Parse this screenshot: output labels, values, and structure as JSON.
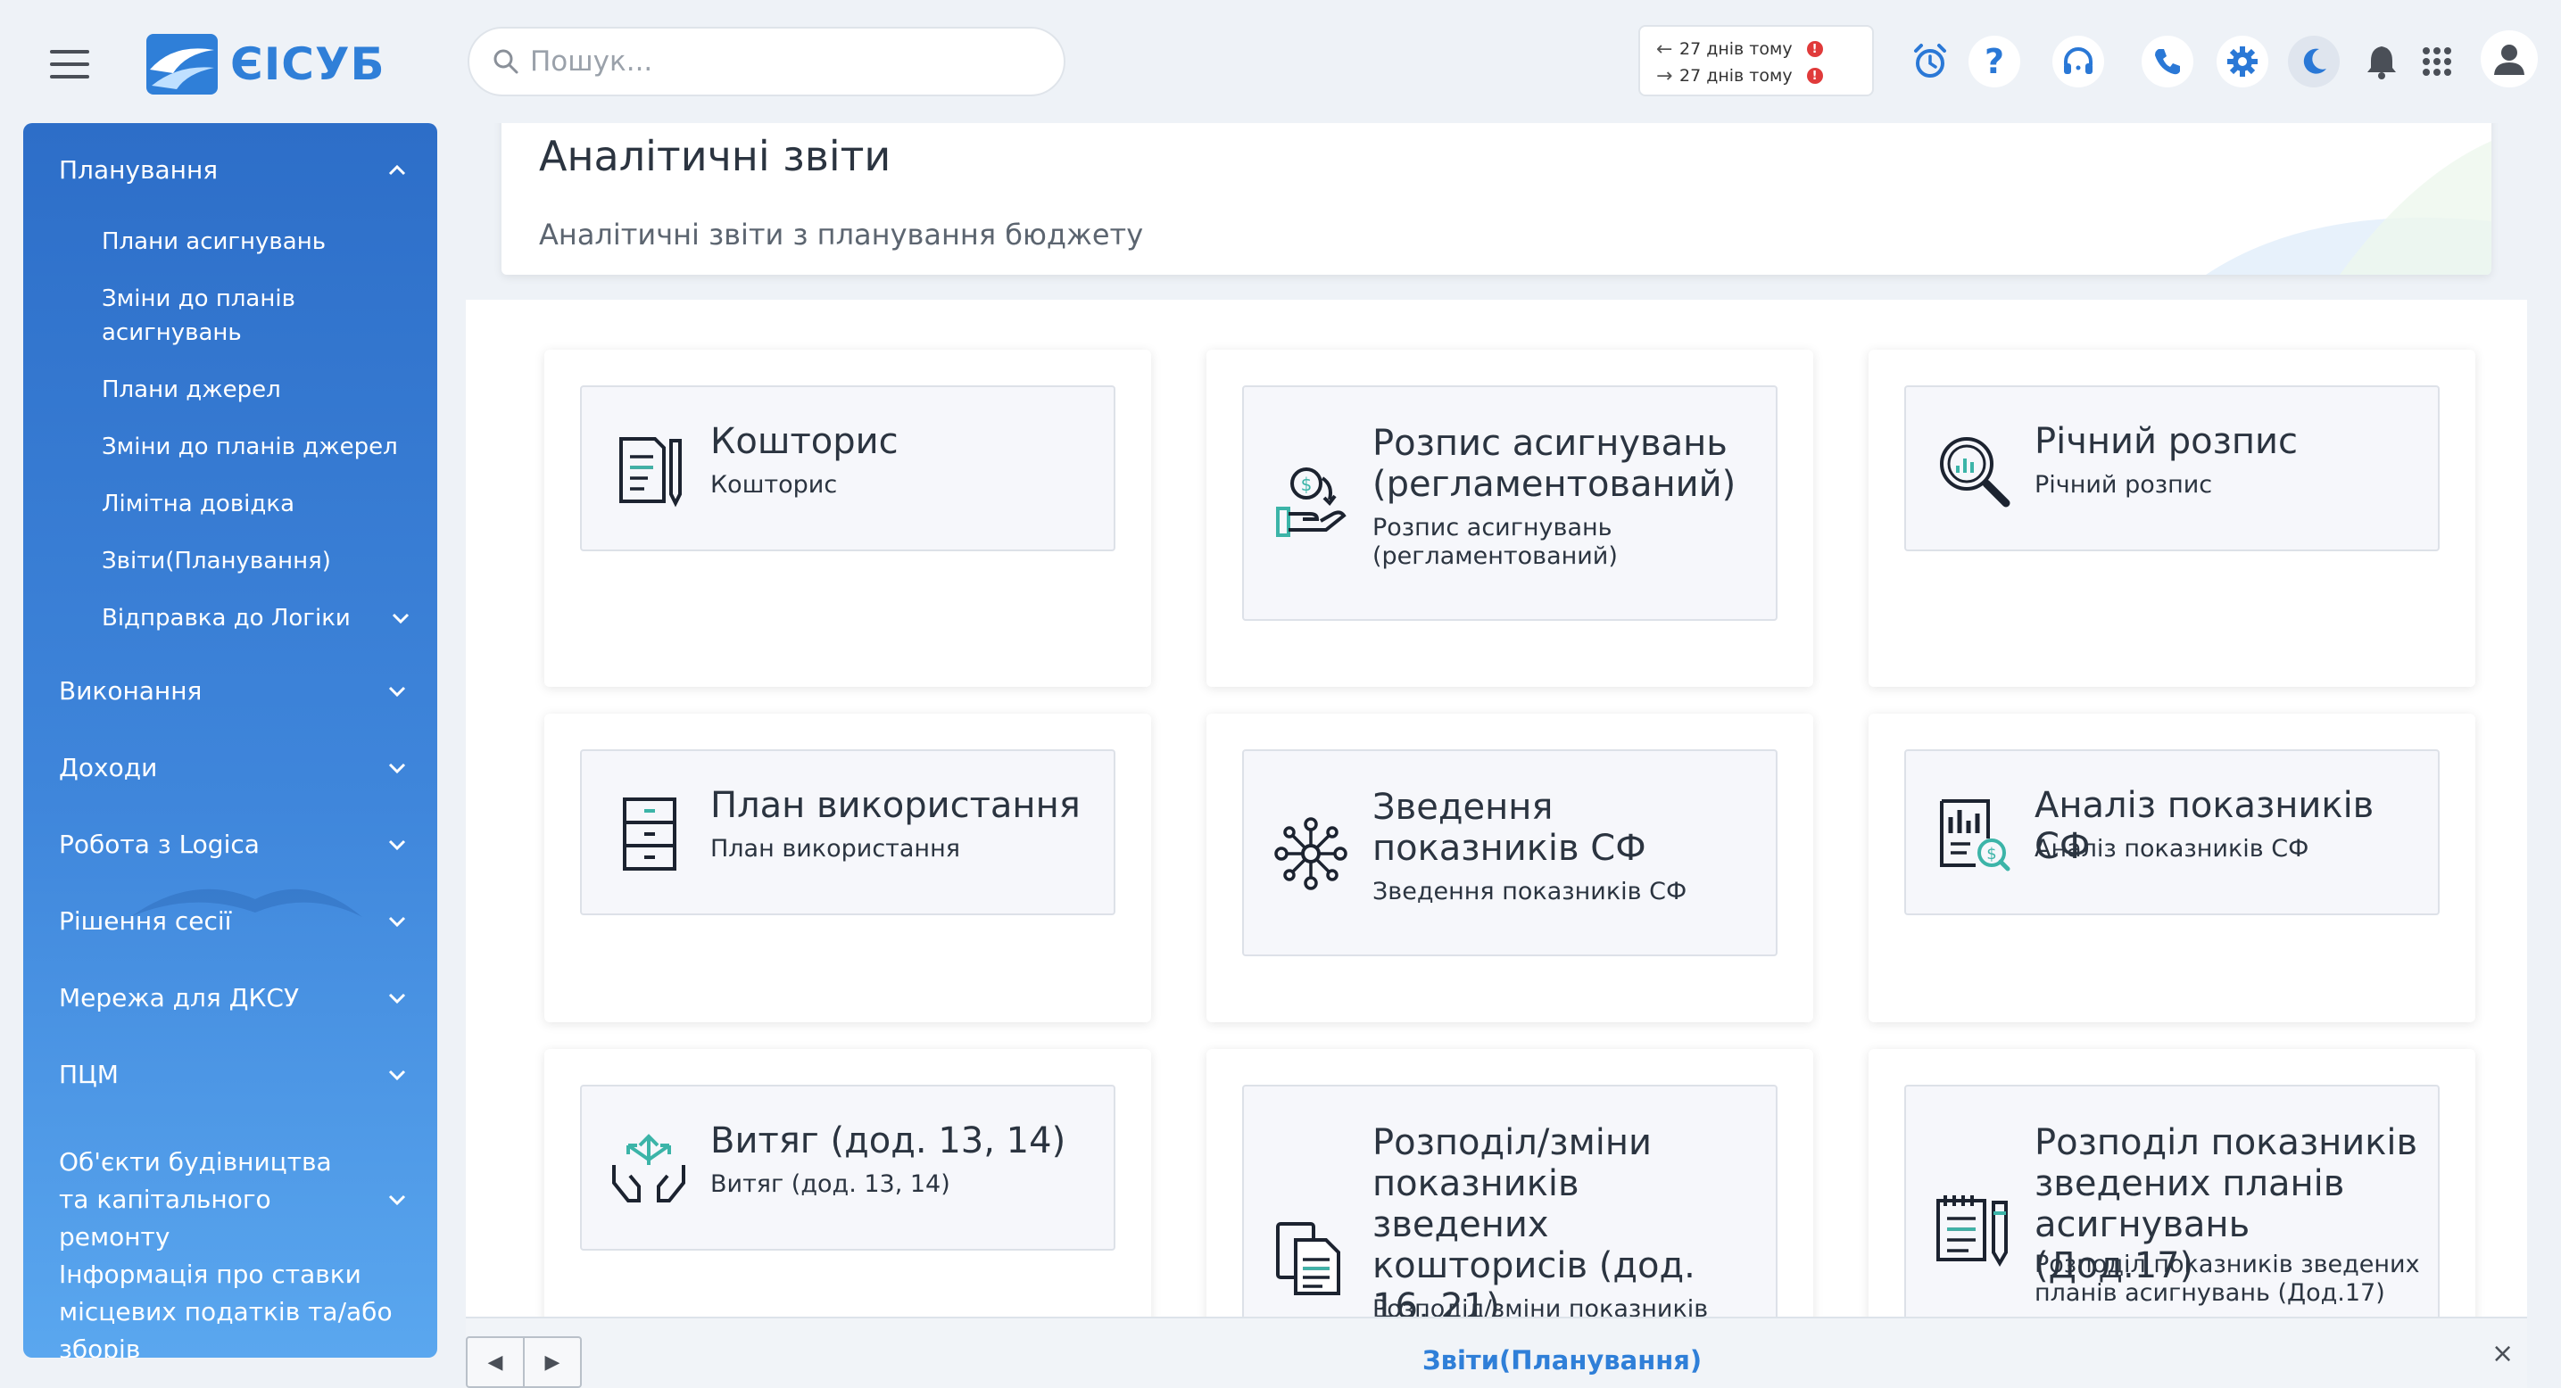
{
  "header": {
    "app_name": "ЄІСУБ",
    "search_placeholder": "Пошук...",
    "sync": [
      {
        "direction": "←",
        "text": "27 днів тому"
      },
      {
        "direction": "→",
        "text": "27 днів тому"
      }
    ],
    "icons": [
      "alarm-clock-icon",
      "help-icon",
      "headset-icon",
      "phone-icon",
      "gear-icon",
      "moon-icon",
      "bell-icon",
      "apps-grid-icon",
      "user-icon"
    ]
  },
  "sidebar": {
    "sections": [
      {
        "label": "Планування",
        "expanded": true
      },
      {
        "label": "Виконання"
      },
      {
        "label": "Доходи"
      },
      {
        "label": "Робота з Logica"
      },
      {
        "label": "Рішення сесії"
      },
      {
        "label": "Мережа для ДКСУ"
      },
      {
        "label": "ПЦМ"
      },
      {
        "label": "Об'єкти будівництва та капітального ремонту"
      },
      {
        "label": "Інформація про ставки місцевих податків та/або зборів"
      }
    ],
    "planning_items": [
      "Плани асигнувань",
      "Зміни до планів асигнувань",
      "Плани джерел",
      "Зміни до планів джерел",
      "Лімітна довідка",
      "Звіти(Планування)",
      "Відправка до Логіки"
    ]
  },
  "banner": {
    "title": "Аналітичні звіти",
    "subtitle": "Аналітичні звіти з планування бюджету"
  },
  "cards": [
    {
      "title": "Кошторис",
      "subtitle": "Кошторис",
      "icon": "document-pen-icon"
    },
    {
      "title": "Розпис асигнувань (регламентований)",
      "subtitle": "Розпис асигнувань (регламентований)",
      "icon": "hand-money-icon"
    },
    {
      "title": "Річний розпис",
      "subtitle": "Річний розпис",
      "icon": "magnifier-chart-icon"
    },
    {
      "title": "План використання",
      "subtitle": "План використання",
      "icon": "cabinet-icon"
    },
    {
      "title": "Зведення показників СФ",
      "subtitle": "Зведення показників СФ",
      "icon": "network-icon"
    },
    {
      "title": "Аналіз показників СФ",
      "subtitle": "Аналіз показників СФ",
      "icon": "report-money-icon"
    },
    {
      "title": "Витяг (дод. 13, 14)",
      "subtitle": "Витяг (дод. 13, 14)",
      "icon": "hands-arrows-icon"
    },
    {
      "title": "Розподіл/зміни показників зведених кошторисів (дод. 16, 21)",
      "subtitle": "Розподіл/зміни показників",
      "icon": "documents-icon"
    },
    {
      "title": "Розподіл показників зведених планів асигнувань (Дод.17)",
      "subtitle": "Розподіл показників зведених планів асигнувань (Дод.17)",
      "icon": "notepad-pencil-icon"
    }
  ],
  "bottombar": {
    "tab_label": "Звіти(Планування)",
    "prev_label": "◀",
    "next_label": "▶",
    "close_label": "×"
  }
}
